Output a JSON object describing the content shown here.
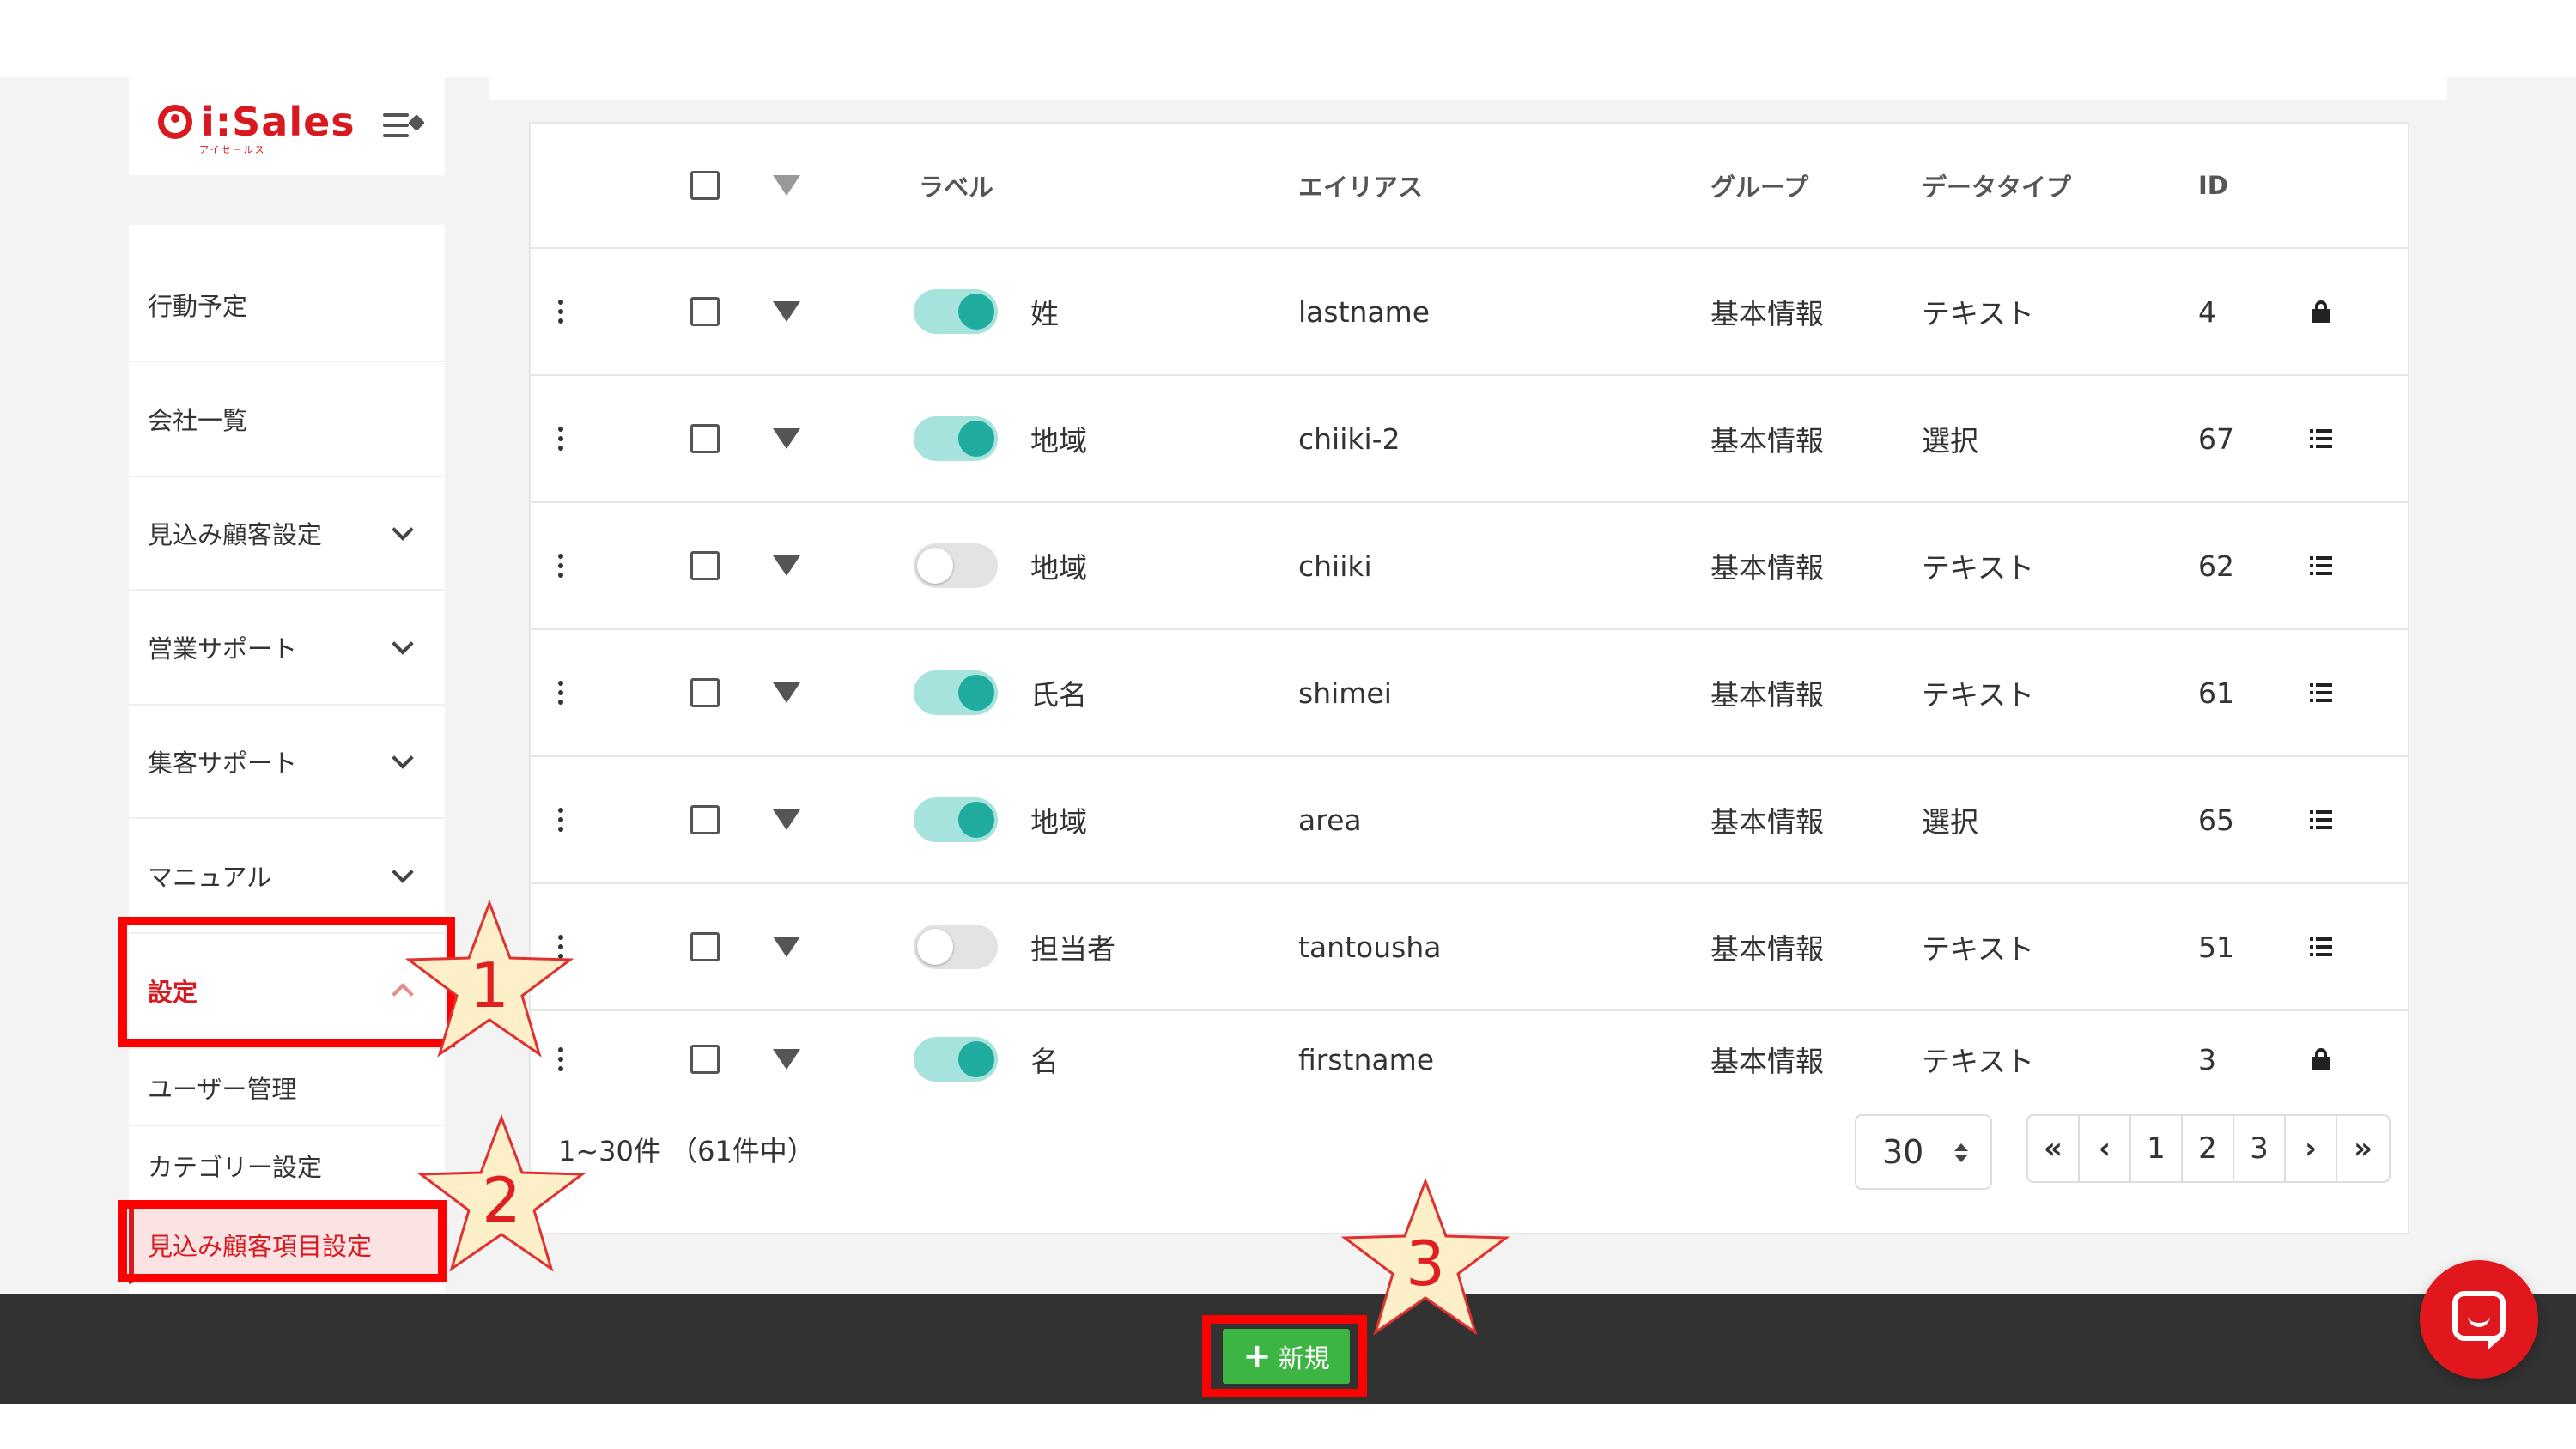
{
  "logo": {
    "text": "i:Sales",
    "sub": "アイセールス"
  },
  "sidebar": {
    "items": [
      {
        "label": "行動予定"
      },
      {
        "label": "会社一覧"
      },
      {
        "label": "見込み顧客設定"
      },
      {
        "label": "営業サポート"
      },
      {
        "label": "集客サポート"
      },
      {
        "label": "マニュアル"
      },
      {
        "label": "設定"
      }
    ],
    "sub_items": [
      {
        "label": "ユーザー管理"
      },
      {
        "label": "カテゴリー設定"
      },
      {
        "label": "見込み顧客項目設定"
      }
    ]
  },
  "table": {
    "headers": {
      "label": "ラベル",
      "alias": "エイリアス",
      "group": "グループ",
      "datatype": "データタイプ",
      "id": "ID"
    },
    "rows": [
      {
        "enabled": true,
        "label": "姓",
        "alias": "lastname",
        "group": "基本情報",
        "datatype": "テキスト",
        "id": "4",
        "icon": "lock-icon"
      },
      {
        "enabled": true,
        "label": "地域",
        "alias": "chiiki-2",
        "group": "基本情報",
        "datatype": "選択",
        "id": "67",
        "icon": "list-icon"
      },
      {
        "enabled": false,
        "label": "地域",
        "alias": "chiiki",
        "group": "基本情報",
        "datatype": "テキスト",
        "id": "62",
        "icon": "list-icon"
      },
      {
        "enabled": true,
        "label": "氏名",
        "alias": "shimei",
        "group": "基本情報",
        "datatype": "テキスト",
        "id": "61",
        "icon": "list-icon"
      },
      {
        "enabled": true,
        "label": "地域",
        "alias": "area",
        "group": "基本情報",
        "datatype": "選択",
        "id": "65",
        "icon": "list-icon"
      },
      {
        "enabled": false,
        "label": "担当者",
        "alias": "tantousha",
        "group": "基本情報",
        "datatype": "テキスト",
        "id": "51",
        "icon": "list-icon"
      },
      {
        "enabled": true,
        "label": "名",
        "alias": "firstname",
        "group": "基本情報",
        "datatype": "テキスト",
        "id": "3",
        "icon": "lock-icon"
      }
    ]
  },
  "pagination": {
    "count_text": "1~30件 （61件中）",
    "per_page": "30",
    "first": "«",
    "prev": "‹",
    "pages": [
      "1",
      "2",
      "3"
    ],
    "next": "›",
    "last": "»"
  },
  "new_button": {
    "label": "新規"
  },
  "annotations": [
    "1",
    "2",
    "3"
  ],
  "colors": {
    "brand": "#d8191f",
    "toggle_on": "#1fab9d",
    "new_button": "#3cb543",
    "highlight": "#ff0000"
  }
}
